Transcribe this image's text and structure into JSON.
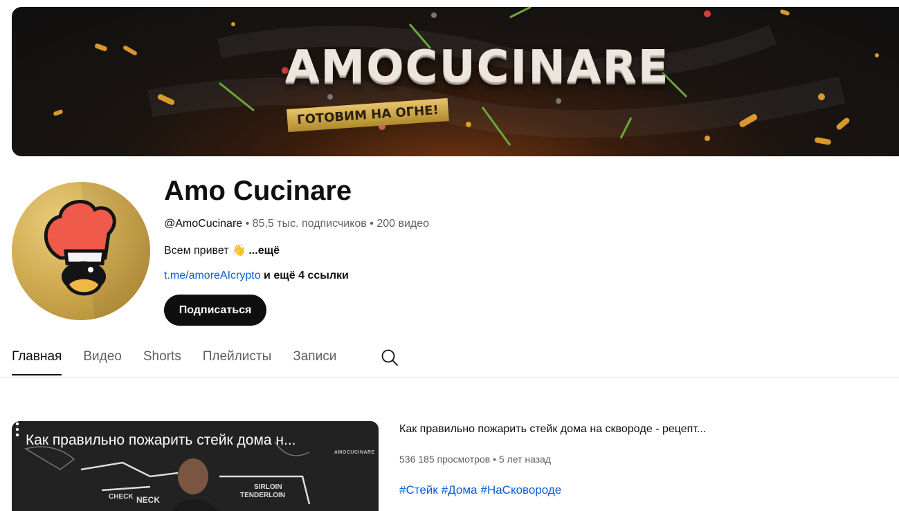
{
  "banner": {
    "title": "AMOCUCINARE",
    "tagline": "ГОТОВИМ НА ОГНЕ!"
  },
  "channel": {
    "name": "Amo Cucinare",
    "handle": "@AmoCucinare",
    "separator": " • ",
    "subscribers": "85,5 тыс. подписчиков",
    "videos": "200 видео",
    "description": "Всем привет",
    "description_emoji": "👋",
    "more": "...ещё",
    "link": "t.me/amoreAIcrypto",
    "more_links": " и ещё 4 ссылки",
    "subscribe_label": "Подписаться"
  },
  "tabs": [
    {
      "label": "Главная",
      "active": true
    },
    {
      "label": "Видео"
    },
    {
      "label": "Shorts"
    },
    {
      "label": "Плейлисты"
    },
    {
      "label": "Записи"
    }
  ],
  "featured_video": {
    "thumbnail_title": "Как правильно пожарить стейк дома н...",
    "thumbnail_logo": "AMOCUCINARE",
    "thumbnail_words": [
      "SIRLOIN",
      "TENDERLOIN",
      "CHECK",
      "NECK"
    ],
    "title": "Как правильно пожарить стейк дома на скворoде - рецепт...",
    "views": "536 185 просмотров",
    "age": "5 лет назад",
    "hashtags": [
      "#Стейк",
      "#Дома",
      "#НаСковороде"
    ]
  },
  "colors": {
    "accent_link": "#065fd4",
    "subscribe_bg": "#0f0f0f",
    "avatar_gold": "#cfa94f"
  }
}
